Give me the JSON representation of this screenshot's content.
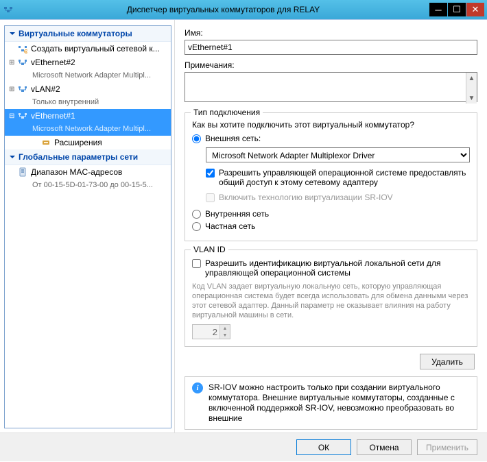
{
  "window": {
    "title": "Диспетчер виртуальных коммутаторов для RELAY"
  },
  "tree": {
    "hdr_switches": "Виртуальные коммутаторы",
    "create_label": "Создать виртуальный сетевой к...",
    "sw1_name": "vEthernet#2",
    "sw1_sub": "Microsoft Network Adapter Multipl...",
    "sw2_name": "vLAN#2",
    "sw2_sub": "Только внутренний",
    "sw3_name": "vEthernet#1",
    "sw3_sub": "Microsoft Network Adapter Multipl...",
    "sw3_ext": "Расширения",
    "hdr_global": "Глобальные параметры сети",
    "mac_name": "Диапазон MAC-адресов",
    "mac_sub": "От 00-15-5D-01-73-00 до 00-15-5..."
  },
  "props": {
    "name_label": "Имя:",
    "name_value": "vEthernet#1",
    "notes_label": "Примечания:",
    "notes_value": "",
    "conn_legend": "Тип подключения",
    "conn_prompt": "Как вы хотите подключить этот виртуальный коммутатор?",
    "r_ext": "Внешняя сеть:",
    "adapter_sel": "Microsoft Network Adapter Multiplexor Driver",
    "allow_mgmt": "Разрешить управляющей операционной системе предоставлять общий доступ к этому сетевому адаптеру",
    "sriov": "Включить технологию виртуализации SR-IOV",
    "r_int": "Внутренняя сеть",
    "r_priv": "Частная сеть",
    "vlan_legend": "VLAN ID",
    "vlan_enable": "Разрешить идентификацию виртуальной локальной сети для управляющей операционной системы",
    "vlan_help": "Код VLAN задает виртуальную локальную сеть, которую управляющая операционная система будет всегда использовать для обмена данными через этот сетевой адаптер. Данный параметр не оказывает влияния на работу виртуальной машины в сети.",
    "vlan_value": "2",
    "delete_btn": "Удалить",
    "sriov_info": "SR-IOV можно настроить только при создании виртуального коммутатора. Внешние виртуальные коммутаторы, созданные с включенной поддержкой SR-IOV, невозможно преобразовать во внешние"
  },
  "buttons": {
    "ok": "ОК",
    "cancel": "Отмена",
    "apply": "Применить"
  }
}
